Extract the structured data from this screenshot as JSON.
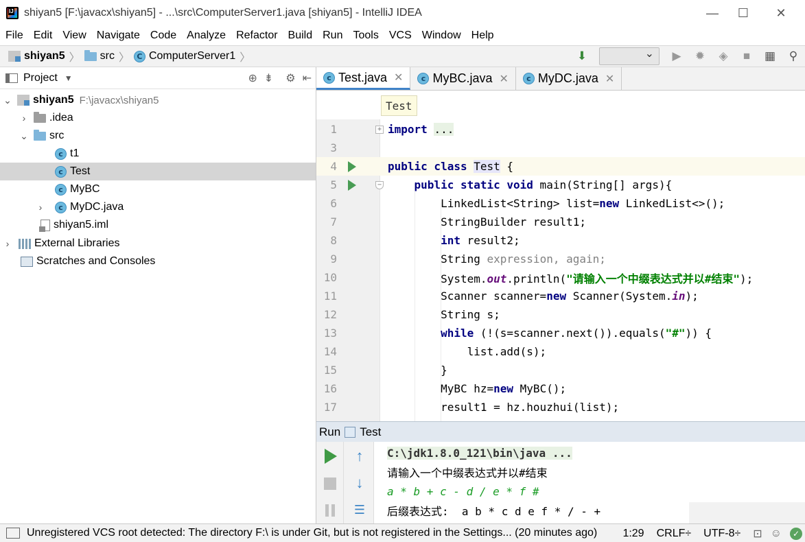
{
  "window": {
    "title": "shiyan5 [F:\\javacx\\shiyan5] - ...\\src\\ComputerServer1.java [shiyan5] - IntelliJ IDEA",
    "minimize": "—",
    "maximize": "☐",
    "close": "✕"
  },
  "menu": [
    "File",
    "Edit",
    "View",
    "Navigate",
    "Code",
    "Analyze",
    "Refactor",
    "Build",
    "Run",
    "Tools",
    "VCS",
    "Window",
    "Help"
  ],
  "navbar": {
    "crumbs": [
      "shiyan5",
      "src",
      "ComputerServer1"
    ]
  },
  "project_panel": {
    "title": "Project",
    "tree": [
      {
        "label": "shiyan5",
        "path": "F:\\javacx\\shiyan5"
      },
      {
        "label": ".idea"
      },
      {
        "label": "src"
      },
      {
        "label": "t1"
      },
      {
        "label": "Test"
      },
      {
        "label": "MyBC"
      },
      {
        "label": "MyDC.java"
      },
      {
        "label": "shiyan5.iml"
      },
      {
        "label": "External Libraries"
      },
      {
        "label": "Scratches and Consoles"
      }
    ]
  },
  "editor": {
    "tabs": [
      "Test.java",
      "MyBC.java",
      "MyDC.java"
    ],
    "breadcrumb": "Test",
    "line_numbers": [
      "1",
      "3",
      "4",
      "5",
      "6",
      "7",
      "8",
      "9",
      "10",
      "11",
      "12",
      "13",
      "14",
      "15",
      "16",
      "17"
    ]
  },
  "run": {
    "label": "Run",
    "config": "Test",
    "console": {
      "cmd": "C:\\jdk1.8.0_121\\bin\\java ...",
      "prompt": "请输入一个中缀表达式并以#结束",
      "input": "a * b + c - d / e * f #",
      "result": "后缀表达式:  a b * c d e f * / - +"
    }
  },
  "status": {
    "message": "Unregistered VCS root detected: The directory F:\\ is under Git, but is not registered in the Settings... (20 minutes ago)",
    "position": "1:29",
    "line_sep": "CRLF÷",
    "encoding": "UTF-8÷"
  }
}
